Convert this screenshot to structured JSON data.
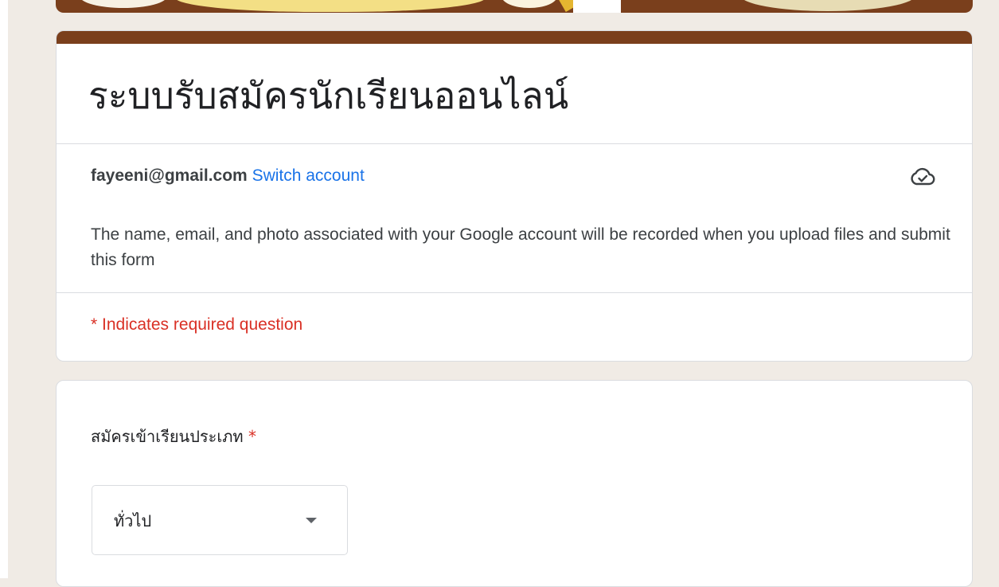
{
  "form": {
    "title": "ระบบรับสมัครนักเรียนออนไลน์",
    "theme_color": "#7a3f1c",
    "account": {
      "email": "fayeeni@gmail.com",
      "switch_label": "Switch account",
      "status_icon": "cloud-check-icon"
    },
    "notice": "The name, email, and photo associated with your Google account will be recorded when you upload files and submit this form",
    "required_note": "* Indicates required question"
  },
  "question": {
    "label": "สมัครเข้าเรียนประเภท",
    "required_marker": "*",
    "selected_value": "ทั่วไป"
  }
}
